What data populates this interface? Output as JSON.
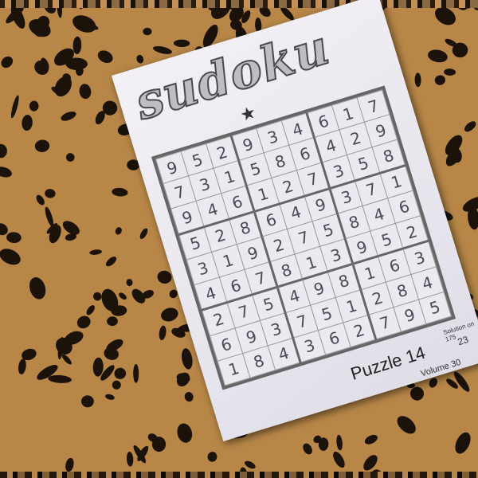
{
  "colors": {
    "fabric_base": "#b88748",
    "fabric_spots": "#1b120a",
    "paper": "#eeecf2",
    "grid_lines": "#666666"
  },
  "puzzle": {
    "title": "sudoku",
    "star": "★",
    "label": "Puzzle 14",
    "solution_note": "Solution on 175",
    "page_number": "23",
    "volume": "Volume 30",
    "grid": [
      [
        "9",
        "5",
        "2",
        "9",
        "3",
        "4",
        "6",
        "1",
        "7"
      ],
      [
        "7",
        "3",
        "1",
        "5",
        "8",
        "6",
        "4",
        "2",
        "9"
      ],
      [
        "9",
        "4",
        "6",
        "1",
        "2",
        "7",
        "3",
        "5",
        "8"
      ],
      [
        "5",
        "2",
        "8",
        "6",
        "4",
        "9",
        "3",
        "7",
        "1"
      ],
      [
        "3",
        "1",
        "9",
        "2",
        "7",
        "5",
        "8",
        "4",
        "6"
      ],
      [
        "4",
        "6",
        "7",
        "8",
        "1",
        "3",
        "9",
        "5",
        "2"
      ],
      [
        "2",
        "7",
        "5",
        "4",
        "9",
        "8",
        "1",
        "6",
        "3"
      ],
      [
        "6",
        "9",
        "3",
        "7",
        "5",
        "1",
        "2",
        "8",
        "4"
      ],
      [
        "1",
        "8",
        "4",
        "3",
        "6",
        "2",
        "7",
        "9",
        "5"
      ]
    ]
  }
}
